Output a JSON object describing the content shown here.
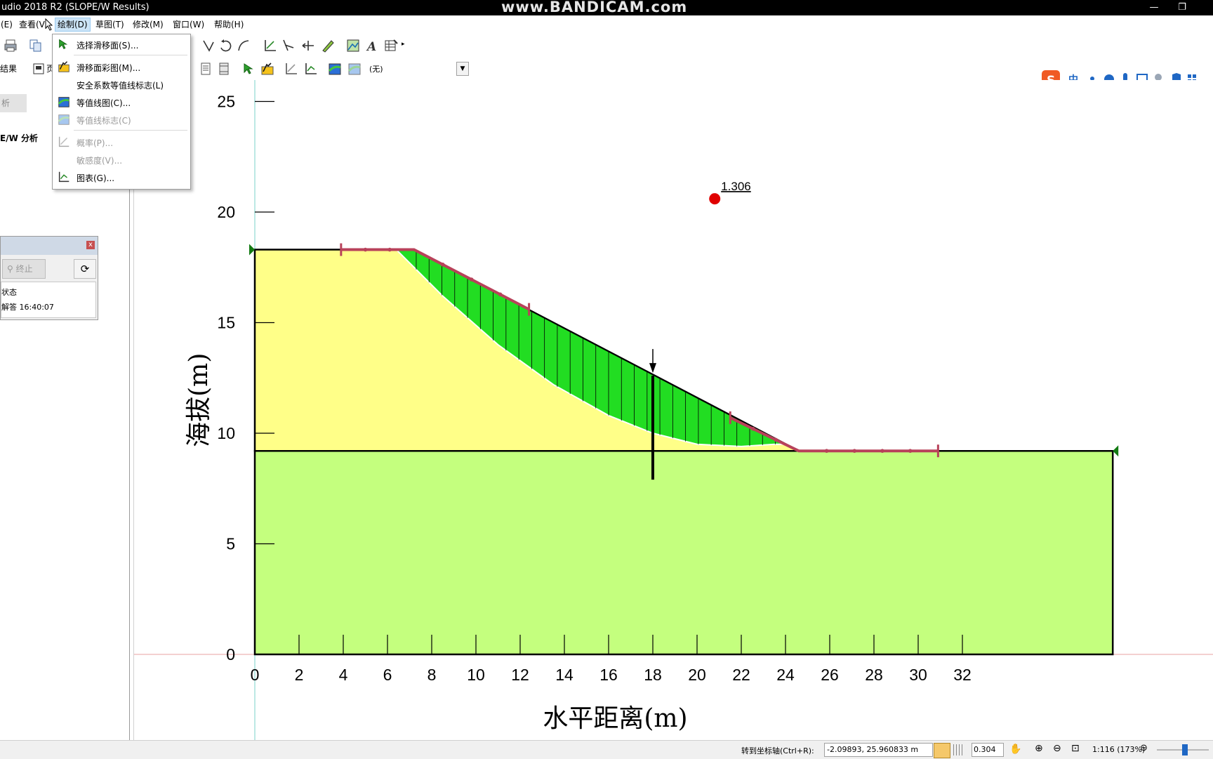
{
  "window": {
    "title": "udio 2018 R2 (SLOPE/W Results)",
    "watermark": "www.BANDICAM.com"
  },
  "menubar": {
    "items": [
      {
        "label": "(E)"
      },
      {
        "label": "查看(V)"
      },
      {
        "label": "绘制(D)"
      },
      {
        "label": "草图(T)"
      },
      {
        "label": "修改(M)"
      },
      {
        "label": "窗口(W)"
      },
      {
        "label": "帮助(H)"
      }
    ]
  },
  "dropdown": {
    "items": [
      {
        "label": "选择滑移面(S)...",
        "enabled": true,
        "icon": "select-slip-icon"
      },
      {
        "label": "滑移面彩图(M)...",
        "enabled": true,
        "icon": "slip-color-map-icon"
      },
      {
        "label": "安全系数等值线标志(L)",
        "enabled": true,
        "icon": ""
      },
      {
        "label": "等值线图(C)...",
        "enabled": true,
        "icon": "contour-icon"
      },
      {
        "label": "等值线标志(C)",
        "enabled": false,
        "icon": "contour-label-icon"
      },
      {
        "label": "概率(P)...",
        "enabled": false,
        "icon": "probability-icon"
      },
      {
        "label": "敏感度(V)...",
        "enabled": false,
        "icon": ""
      },
      {
        "label": "图表(G)...",
        "enabled": true,
        "icon": "graph-icon"
      }
    ]
  },
  "toolbar": {
    "results_tab": "结果",
    "page_label": "页",
    "style_select": "(无)"
  },
  "left_panel": {
    "shaded_label": "析",
    "analysis_label": "E/W 分析",
    "solver": {
      "stop_label": "终止",
      "status_title": "状态",
      "status_line": "解答 16:40:07"
    }
  },
  "chart_data": {
    "type": "slope-stability-section",
    "xlabel": "水平距离(m)",
    "ylabel": "海拔(m)",
    "xlim": [
      0,
      32
    ],
    "ylim": [
      0,
      25
    ],
    "xticks": [
      0,
      2,
      4,
      6,
      8,
      10,
      12,
      14,
      16,
      18,
      20,
      22,
      24,
      26,
      28,
      30,
      32
    ],
    "yticks": [
      0,
      5,
      10,
      15,
      20,
      25
    ],
    "factor_of_safety": "1.306",
    "slip_center": [
      20.8,
      20.6
    ],
    "ground_profile": [
      [
        0,
        18.3
      ],
      [
        7.2,
        18.3
      ],
      [
        24.6,
        9.2
      ],
      [
        38.8,
        9.2
      ]
    ],
    "layer_boundary_y": 9.2,
    "model_right_x": 38.8,
    "slip_surface": [
      [
        6.4,
        18.3
      ],
      [
        8.5,
        16.2
      ],
      [
        11,
        14.0
      ],
      [
        13.5,
        12.2
      ],
      [
        16,
        10.8
      ],
      [
        18,
        10.0
      ],
      [
        20,
        9.5
      ],
      [
        22,
        9.4
      ],
      [
        23.5,
        9.5
      ],
      [
        24.0,
        9.5
      ]
    ],
    "slice_range": [
      7.3,
      23.6
    ],
    "slice_width": 0.58,
    "entry_range": [
      [
        3.9,
        18.3
      ],
      [
        7.2,
        18.3
      ],
      [
        12.4,
        15.6
      ]
    ],
    "exit_range": [
      [
        21.5,
        10.7
      ],
      [
        24.6,
        9.2
      ],
      [
        30.9,
        9.2
      ]
    ],
    "point_load": {
      "x": 18.0,
      "y_top": 12.6
    },
    "pile": {
      "x": 18.0,
      "y_top": 12.6,
      "y_bottom": 7.9
    },
    "colors": {
      "upper_layer": "#ffff88",
      "lower_layer": "#c4ff7e",
      "slip_mass": "#22dd22",
      "range_line": "#b8425a",
      "fos_point": "#e00000",
      "anchor_marker": "#127a12"
    }
  },
  "statusbar": {
    "coord_label": "转到坐标轴(Ctrl+R):",
    "coord_value": "-2.09893, 25.960833 m",
    "step_value": "0.304",
    "zoom_label": "1:116 (173%)"
  }
}
